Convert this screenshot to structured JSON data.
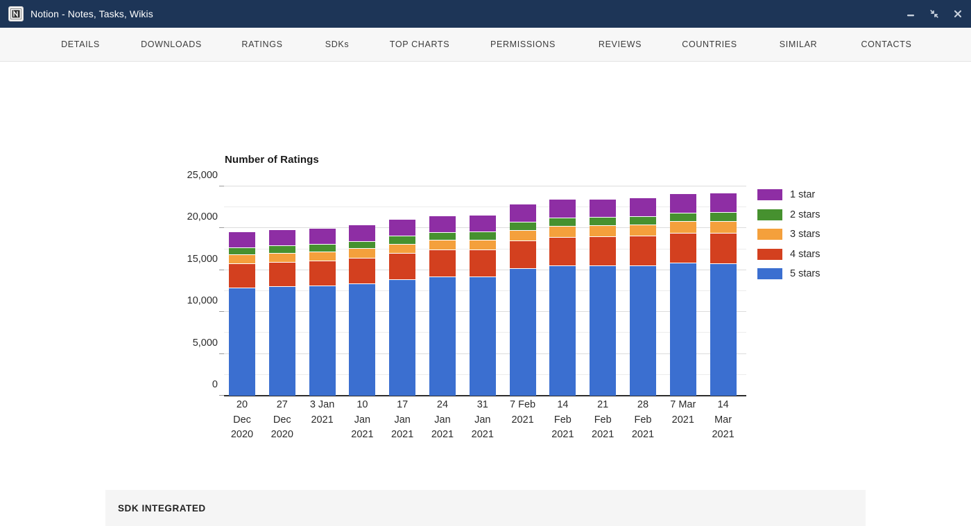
{
  "window": {
    "title": "Notion - Notes, Tasks, Wikis",
    "icon": "notion-logo-icon",
    "controls": [
      {
        "name": "minimize",
        "glyph": "minimize-icon"
      },
      {
        "name": "restore",
        "glyph": "restore-icon"
      },
      {
        "name": "close",
        "glyph": "close-icon"
      }
    ],
    "titlebar_color": "#1d3557"
  },
  "nav": {
    "tabs": [
      {
        "label": "DETAILS"
      },
      {
        "label": "DOWNLOADS"
      },
      {
        "label": "RATINGS"
      },
      {
        "label": "SDKs"
      },
      {
        "label": "TOP CHARTS"
      },
      {
        "label": "PERMISSIONS"
      },
      {
        "label": "REVIEWS"
      },
      {
        "label": "COUNTRIES"
      },
      {
        "label": "SIMILAR"
      },
      {
        "label": "CONTACTS"
      }
    ]
  },
  "sections": {
    "sdk_integrated_title": "SDK INTEGRATED"
  },
  "chart_data": {
    "type": "bar",
    "stacked": true,
    "title": "Number of Ratings",
    "xlabel": "",
    "ylabel": "",
    "ylim": [
      0,
      25000
    ],
    "yticks": [
      0,
      5000,
      10000,
      15000,
      20000,
      25000
    ],
    "ytick_labels": [
      "0",
      "5,000",
      "10,000",
      "15,000",
      "20,000",
      "25,000"
    ],
    "grid": true,
    "minor_gridlines": true,
    "legend_position": "right",
    "categories": [
      "20 Dec 2020",
      "27 Dec 2020",
      "3 Jan 2021",
      "10 Jan 2021",
      "17 Jan 2021",
      "24 Jan 2021",
      "31 Jan 2021",
      "7 Feb 2021",
      "14 Feb 2021",
      "21 Feb 2021",
      "28 Feb 2021",
      "7 Mar 2021",
      "14 Mar 2021"
    ],
    "category_lines": [
      [
        "20",
        "Dec",
        "2020"
      ],
      [
        "27",
        "Dec",
        "2020"
      ],
      [
        "3 Jan",
        "2021",
        ""
      ],
      [
        "10",
        "Jan",
        "2021"
      ],
      [
        "17",
        "Jan",
        "2021"
      ],
      [
        "24",
        "Jan",
        "2021"
      ],
      [
        "31",
        "Jan",
        "2021"
      ],
      [
        "7 Feb",
        "2021",
        ""
      ],
      [
        "14",
        "Feb",
        "2021"
      ],
      [
        "21",
        "Feb",
        "2021"
      ],
      [
        "28",
        "Feb",
        "2021"
      ],
      [
        "7 Mar",
        "2021",
        ""
      ],
      [
        "14",
        "Mar",
        "2021"
      ]
    ],
    "stack_order_bottom_to_top": [
      "5 stars",
      "4 stars",
      "3 stars",
      "2 stars",
      "1 star"
    ],
    "series": [
      {
        "name": "1 star",
        "color": "#8e2ea4",
        "values": [
          1850,
          1900,
          1950,
          1950,
          2000,
          2000,
          2050,
          2150,
          2200,
          2200,
          2250,
          2350,
          2350
        ]
      },
      {
        "name": "2 stars",
        "color": "#46912f",
        "values": [
          900,
          900,
          900,
          900,
          950,
          950,
          950,
          1000,
          1000,
          1000,
          1000,
          1000,
          1000
        ]
      },
      {
        "name": "3 stars",
        "color": "#f4a03c",
        "values": [
          1000,
          1050,
          1050,
          1100,
          1100,
          1150,
          1150,
          1250,
          1300,
          1300,
          1350,
          1400,
          1450
        ]
      },
      {
        "name": "4 stars",
        "color": "#d3401f",
        "values": [
          2900,
          2950,
          3000,
          3050,
          3150,
          3200,
          3250,
          3350,
          3400,
          3450,
          3500,
          3550,
          3600
        ]
      },
      {
        "name": "5 stars",
        "color": "#3b6fd0",
        "values": [
          12950,
          13050,
          13150,
          13450,
          13900,
          14250,
          14250,
          15200,
          15600,
          15600,
          15600,
          15900,
          15850
        ]
      }
    ],
    "totals": [
      19600,
      19850,
      20050,
      20450,
      21100,
      21550,
      21650,
      22950,
      23500,
      23550,
      23700,
      24200,
      24250
    ],
    "legend": [
      {
        "label": "1 star",
        "color": "#8e2ea4"
      },
      {
        "label": "2 stars",
        "color": "#46912f"
      },
      {
        "label": "3 stars",
        "color": "#f4a03c"
      },
      {
        "label": "4 stars",
        "color": "#d3401f"
      },
      {
        "label": "5 stars",
        "color": "#3b6fd0"
      }
    ]
  }
}
